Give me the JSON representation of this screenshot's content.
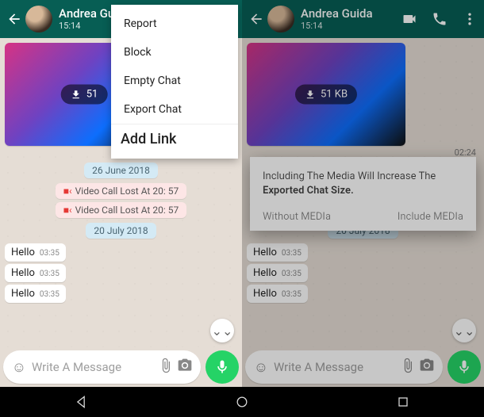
{
  "left": {
    "contact_name": "Andrea Guice",
    "subtime": "15:14",
    "download_size": "51",
    "media_time": "02:24",
    "menu": {
      "report": "Report",
      "block": "Block",
      "empty": "Empty Chat",
      "export": "Export Chat",
      "addlink": "Add Link"
    }
  },
  "right": {
    "contact_name": "Andrea Guida",
    "subtime": "15:14",
    "download_size": "51 KB",
    "dialog_text1": "Including The Media Will Increase The",
    "dialog_text2": "Exported Chat Size.",
    "dialog_without": "Without MEDIa",
    "dialog_include": "Include MEDIa"
  },
  "chat": {
    "date1": "26 June 2018",
    "miss1": "Video Call Lost At 20: 57",
    "miss2": "Video Call Lost At 20: 57",
    "date2": "20 July 2018",
    "hello_text": "Hello",
    "hello_time": "03:35"
  },
  "composer": {
    "placeholder": "Write A Message"
  }
}
